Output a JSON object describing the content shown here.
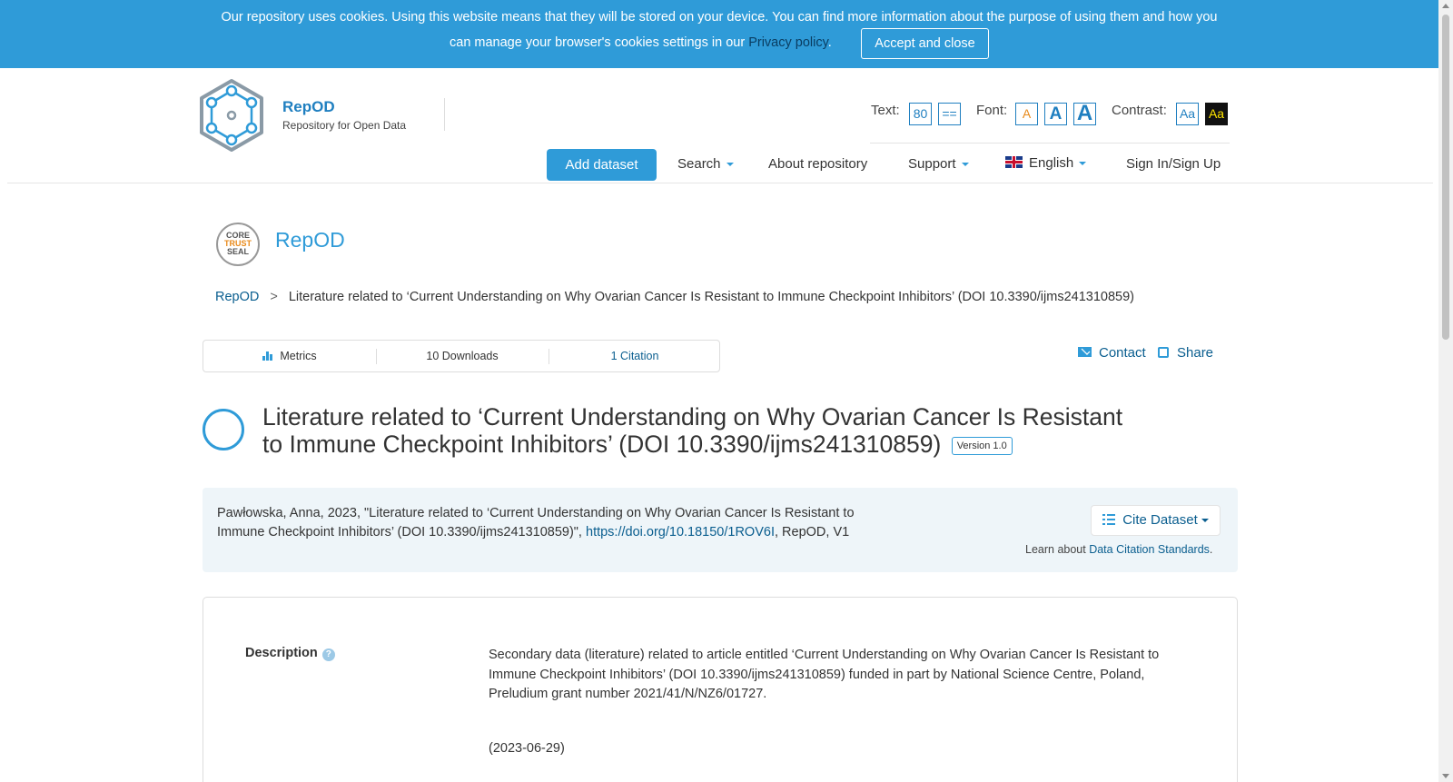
{
  "cookie_banner": {
    "line1": "Our repository uses cookies. Using this website means that they will be stored on your device. You can find more information about the purpose of using them and how you",
    "line2": "can manage your browser's cookies settings in our",
    "privacy_link": "Privacy policy",
    "period": ".",
    "accept_label": "Accept and close"
  },
  "header": {
    "brand_name": "RepOD",
    "brand_subtitle": "Repository for Open Data",
    "accessibility": {
      "text_label": "Text:",
      "text_size_value": "80",
      "text_spacing_value": "==",
      "font_label": "Font:",
      "font_small": "A",
      "font_medium": "A",
      "font_large": "A",
      "contrast_label": "Contrast:",
      "contrast_normal": "Aa",
      "contrast_high": "Aa"
    },
    "nav": {
      "add_dataset": "Add dataset",
      "search": "Search",
      "about": "About repository",
      "support": "Support",
      "language": "English",
      "sign_in": "Sign In/Sign Up"
    }
  },
  "dataverse": {
    "seal_line1": "CORE",
    "seal_line2": "TRUST",
    "seal_line3": "SEAL",
    "title": "RepOD"
  },
  "breadcrumb": {
    "root": "RepOD",
    "separator": ">",
    "current": "Literature related to ‘Current Understanding on Why Ovarian Cancer Is Resistant to Immune Checkpoint Inhibitors’ (DOI 10.3390/ijms241310859)"
  },
  "metrics": {
    "metrics_label": "Metrics",
    "downloads": "10 Downloads",
    "citations": "1 Citation"
  },
  "actions": {
    "contact": "Contact",
    "share": "Share"
  },
  "dataset": {
    "title": "Literature related to ‘Current Understanding on Why Ovarian Cancer Is Resistant to Immune Checkpoint Inhibitors’ (DOI 10.3390/ijms241310859)",
    "version": "Version 1.0"
  },
  "citation": {
    "text_before": "Pawłowska, Anna, 2023, \"Literature related to ‘Current Understanding on Why Ovarian Cancer Is Resistant to Immune Checkpoint Inhibitors’ (DOI 10.3390/ijms241310859)\", ",
    "doi_link": "https://doi.org/10.18150/1ROV6I",
    "text_after": ", RepOD, V1",
    "cite_button": "Cite Dataset",
    "learn_prefix": "Learn about ",
    "learn_link": "Data Citation Standards",
    "learn_suffix": "."
  },
  "description": {
    "label": "Description",
    "help": "?",
    "text": "Secondary data (literature) related to article entitled ‘Current Understanding on Why Ovarian Cancer Is Resistant to Immune Checkpoint Inhibitors’ (DOI 10.3390/ijms241310859) funded in part by National Science Centre, Poland, Preludium grant number 2021/41/N/NZ6/01727.",
    "date": "(2023-06-29)"
  }
}
